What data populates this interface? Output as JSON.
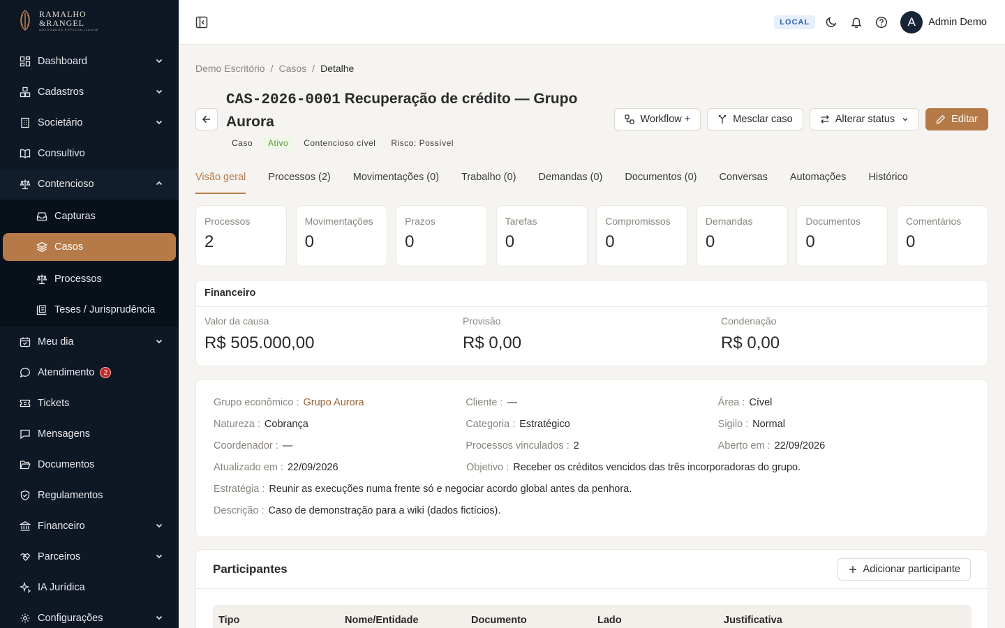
{
  "brand": {
    "line1": "RAMALHO",
    "line2": "&RANGEL",
    "line3": "ADVOGADOS ESPECIALIZADOS"
  },
  "sidebar": {
    "items": [
      {
        "label": "Dashboard"
      },
      {
        "label": "Cadastros"
      },
      {
        "label": "Societário"
      },
      {
        "label": "Consultivo"
      },
      {
        "label": "Contencioso"
      },
      {
        "label": "Capturas"
      },
      {
        "label": "Casos"
      },
      {
        "label": "Processos"
      },
      {
        "label": "Teses / Jurisprudência"
      },
      {
        "label": "Meu dia"
      },
      {
        "label": "Atendimento",
        "badge": "2"
      },
      {
        "label": "Tickets"
      },
      {
        "label": "Mensagens"
      },
      {
        "label": "Documentos"
      },
      {
        "label": "Regulamentos"
      },
      {
        "label": "Financeiro"
      },
      {
        "label": "Parceiros"
      },
      {
        "label": "IA Jurídica"
      },
      {
        "label": "Configurações"
      }
    ]
  },
  "topbar": {
    "env": "LOCAL",
    "user": "Admin Demo",
    "avatar_initial": "A"
  },
  "breadcrumb": [
    "Demo Escritório",
    "Casos",
    "Detalhe"
  ],
  "case": {
    "code": "CAS-2026-0001",
    "title": "Recuperação de crédito — Grupo Aurora",
    "tags": [
      "Caso",
      "Ativo",
      "Contencioso cível",
      "Risco: Possível"
    ]
  },
  "actions": {
    "workflow": "Workflow +",
    "merge": "Mesclar caso",
    "status": "Alterar status",
    "edit": "Editar"
  },
  "tabs": [
    "Visão geral",
    "Processos (2)",
    "Movimentações (0)",
    "Trabalho (0)",
    "Demandas (0)",
    "Documentos (0)",
    "Conversas",
    "Automações",
    "Histórico"
  ],
  "stats": [
    {
      "label": "Processos",
      "value": "2"
    },
    {
      "label": "Movimentações",
      "value": "0"
    },
    {
      "label": "Prazos",
      "value": "0"
    },
    {
      "label": "Tarefas",
      "value": "0"
    },
    {
      "label": "Compromissos",
      "value": "0"
    },
    {
      "label": "Demandas",
      "value": "0"
    },
    {
      "label": "Documentos",
      "value": "0"
    },
    {
      "label": "Comentários",
      "value": "0"
    }
  ],
  "financeiro": {
    "title": "Financeiro",
    "cols": [
      {
        "label": "Valor da causa",
        "value": "R$ 505.000,00"
      },
      {
        "label": "Provisão",
        "value": "R$ 0,00"
      },
      {
        "label": "Condenação",
        "value": "R$ 0,00"
      }
    ]
  },
  "details": {
    "grupo": {
      "label": "Grupo econômico :",
      "value": "Grupo Aurora"
    },
    "cliente": {
      "label": "Cliente :",
      "value": "—"
    },
    "area": {
      "label": "Área :",
      "value": "Cível"
    },
    "natureza": {
      "label": "Natureza :",
      "value": "Cobrança"
    },
    "categoria": {
      "label": "Categoria :",
      "value": "Estratégico"
    },
    "sigilo": {
      "label": "Sigilo :",
      "value": "Normal"
    },
    "coordenador": {
      "label": "Coordenador :",
      "value": "—"
    },
    "vinculados": {
      "label": "Processos vinculados :",
      "value": "2"
    },
    "aberto": {
      "label": "Aberto em :",
      "value": "22/09/2026"
    },
    "atualizado": {
      "label": "Atualizado em :",
      "value": "22/09/2026"
    },
    "objetivo": {
      "label": "Objetivo :",
      "value": "Receber os créditos vencidos das três incorporadoras do grupo."
    },
    "estrategia": {
      "label": "Estratégia :",
      "value": "Reunir as execuções numa frente só e negociar acordo global antes da penhora."
    },
    "descricao": {
      "label": "Descrição :",
      "value": "Caso de demonstração para a wiki (dados fictícios)."
    }
  },
  "participantes": {
    "title": "Participantes",
    "add": "Adicionar participante",
    "columns": [
      "Tipo",
      "Nome/Entidade",
      "Documento",
      "Lado",
      "Justificativa"
    ]
  },
  "colors": {
    "accent": "#b57a48",
    "sidebar_bg": "#0e1724",
    "page_bg": "#f6f4f1"
  }
}
